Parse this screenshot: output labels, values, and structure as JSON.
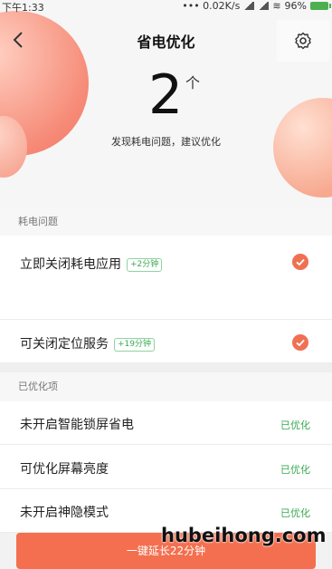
{
  "status_bar": {
    "time": "下午1:33",
    "network": "••• 0.02K/s",
    "battery": "96%"
  },
  "header": {
    "title": "省电优化",
    "back_icon": "chevron-left-icon",
    "settings_icon": "gear-icon"
  },
  "summary": {
    "count": "2",
    "unit": "个",
    "text": "发现耗电问题，建议优化"
  },
  "issues": {
    "heading": "耗电问题",
    "items": [
      {
        "label": "立即关闭耗电应用",
        "tag": "+2分钟"
      },
      {
        "label": "可关闭定位服务",
        "tag": "+19分钟"
      }
    ]
  },
  "optimized": {
    "heading": "已优化项",
    "items": [
      {
        "label": "未开启智能锁屏省电",
        "status": "已优化"
      },
      {
        "label": "可优化屏幕亮度",
        "status": "已优化"
      },
      {
        "label": "未开启神隐模式",
        "status": "已优化"
      }
    ]
  },
  "action_button": {
    "label": "一键延长22分钟"
  },
  "watermark": "hubeihong.com",
  "colors": {
    "accent": "#f36f4f",
    "success": "#3aaa54"
  }
}
